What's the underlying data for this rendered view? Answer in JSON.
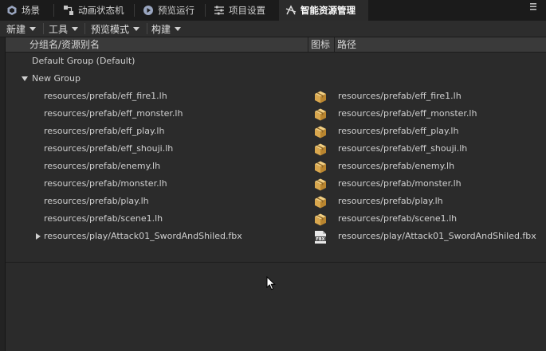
{
  "tabs": [
    {
      "label": "场景",
      "icon": "scene-icon"
    },
    {
      "label": "动画状态机",
      "icon": "state-machine-icon"
    },
    {
      "label": "预览运行",
      "icon": "preview-run-icon"
    },
    {
      "label": "项目设置",
      "icon": "settings-sliders-icon"
    },
    {
      "label": "智能资源管理",
      "icon": "smart-resource-icon",
      "active": true
    }
  ],
  "toolbar": {
    "new_label": "新建",
    "tools_label": "工具",
    "preview_mode_label": "预览模式",
    "build_label": "构建"
  },
  "header": {
    "col_name": "分组名/资源别名",
    "col_icon": "图标",
    "col_path": "路径"
  },
  "groups": {
    "default_group": "Default Group (Default)",
    "new_group": "New Group"
  },
  "items": [
    {
      "name": "resources/prefab/eff_fire1.lh",
      "path": "resources/prefab/eff_fire1.lh",
      "icon": "prefab-box-icon"
    },
    {
      "name": "resources/prefab/eff_monster.lh",
      "path": "resources/prefab/eff_monster.lh",
      "icon": "prefab-box-icon"
    },
    {
      "name": "resources/prefab/eff_play.lh",
      "path": "resources/prefab/eff_play.lh",
      "icon": "prefab-box-icon"
    },
    {
      "name": "resources/prefab/eff_shouji.lh",
      "path": "resources/prefab/eff_shouji.lh",
      "icon": "prefab-box-icon"
    },
    {
      "name": "resources/prefab/enemy.lh",
      "path": "resources/prefab/enemy.lh",
      "icon": "prefab-box-icon"
    },
    {
      "name": "resources/prefab/monster.lh",
      "path": "resources/prefab/monster.lh",
      "icon": "prefab-box-icon"
    },
    {
      "name": "resources/prefab/play.lh",
      "path": "resources/prefab/play.lh",
      "icon": "prefab-box-icon"
    },
    {
      "name": "resources/prefab/scene1.lh",
      "path": "resources/prefab/scene1.lh",
      "icon": "prefab-box-icon"
    },
    {
      "name": "resources/play/Attack01_SwordAndShiled.fbx",
      "path": "resources/play/Attack01_SwordAndShiled.fbx",
      "icon": "fbx-file-icon",
      "fbx_label": "FBX"
    }
  ]
}
